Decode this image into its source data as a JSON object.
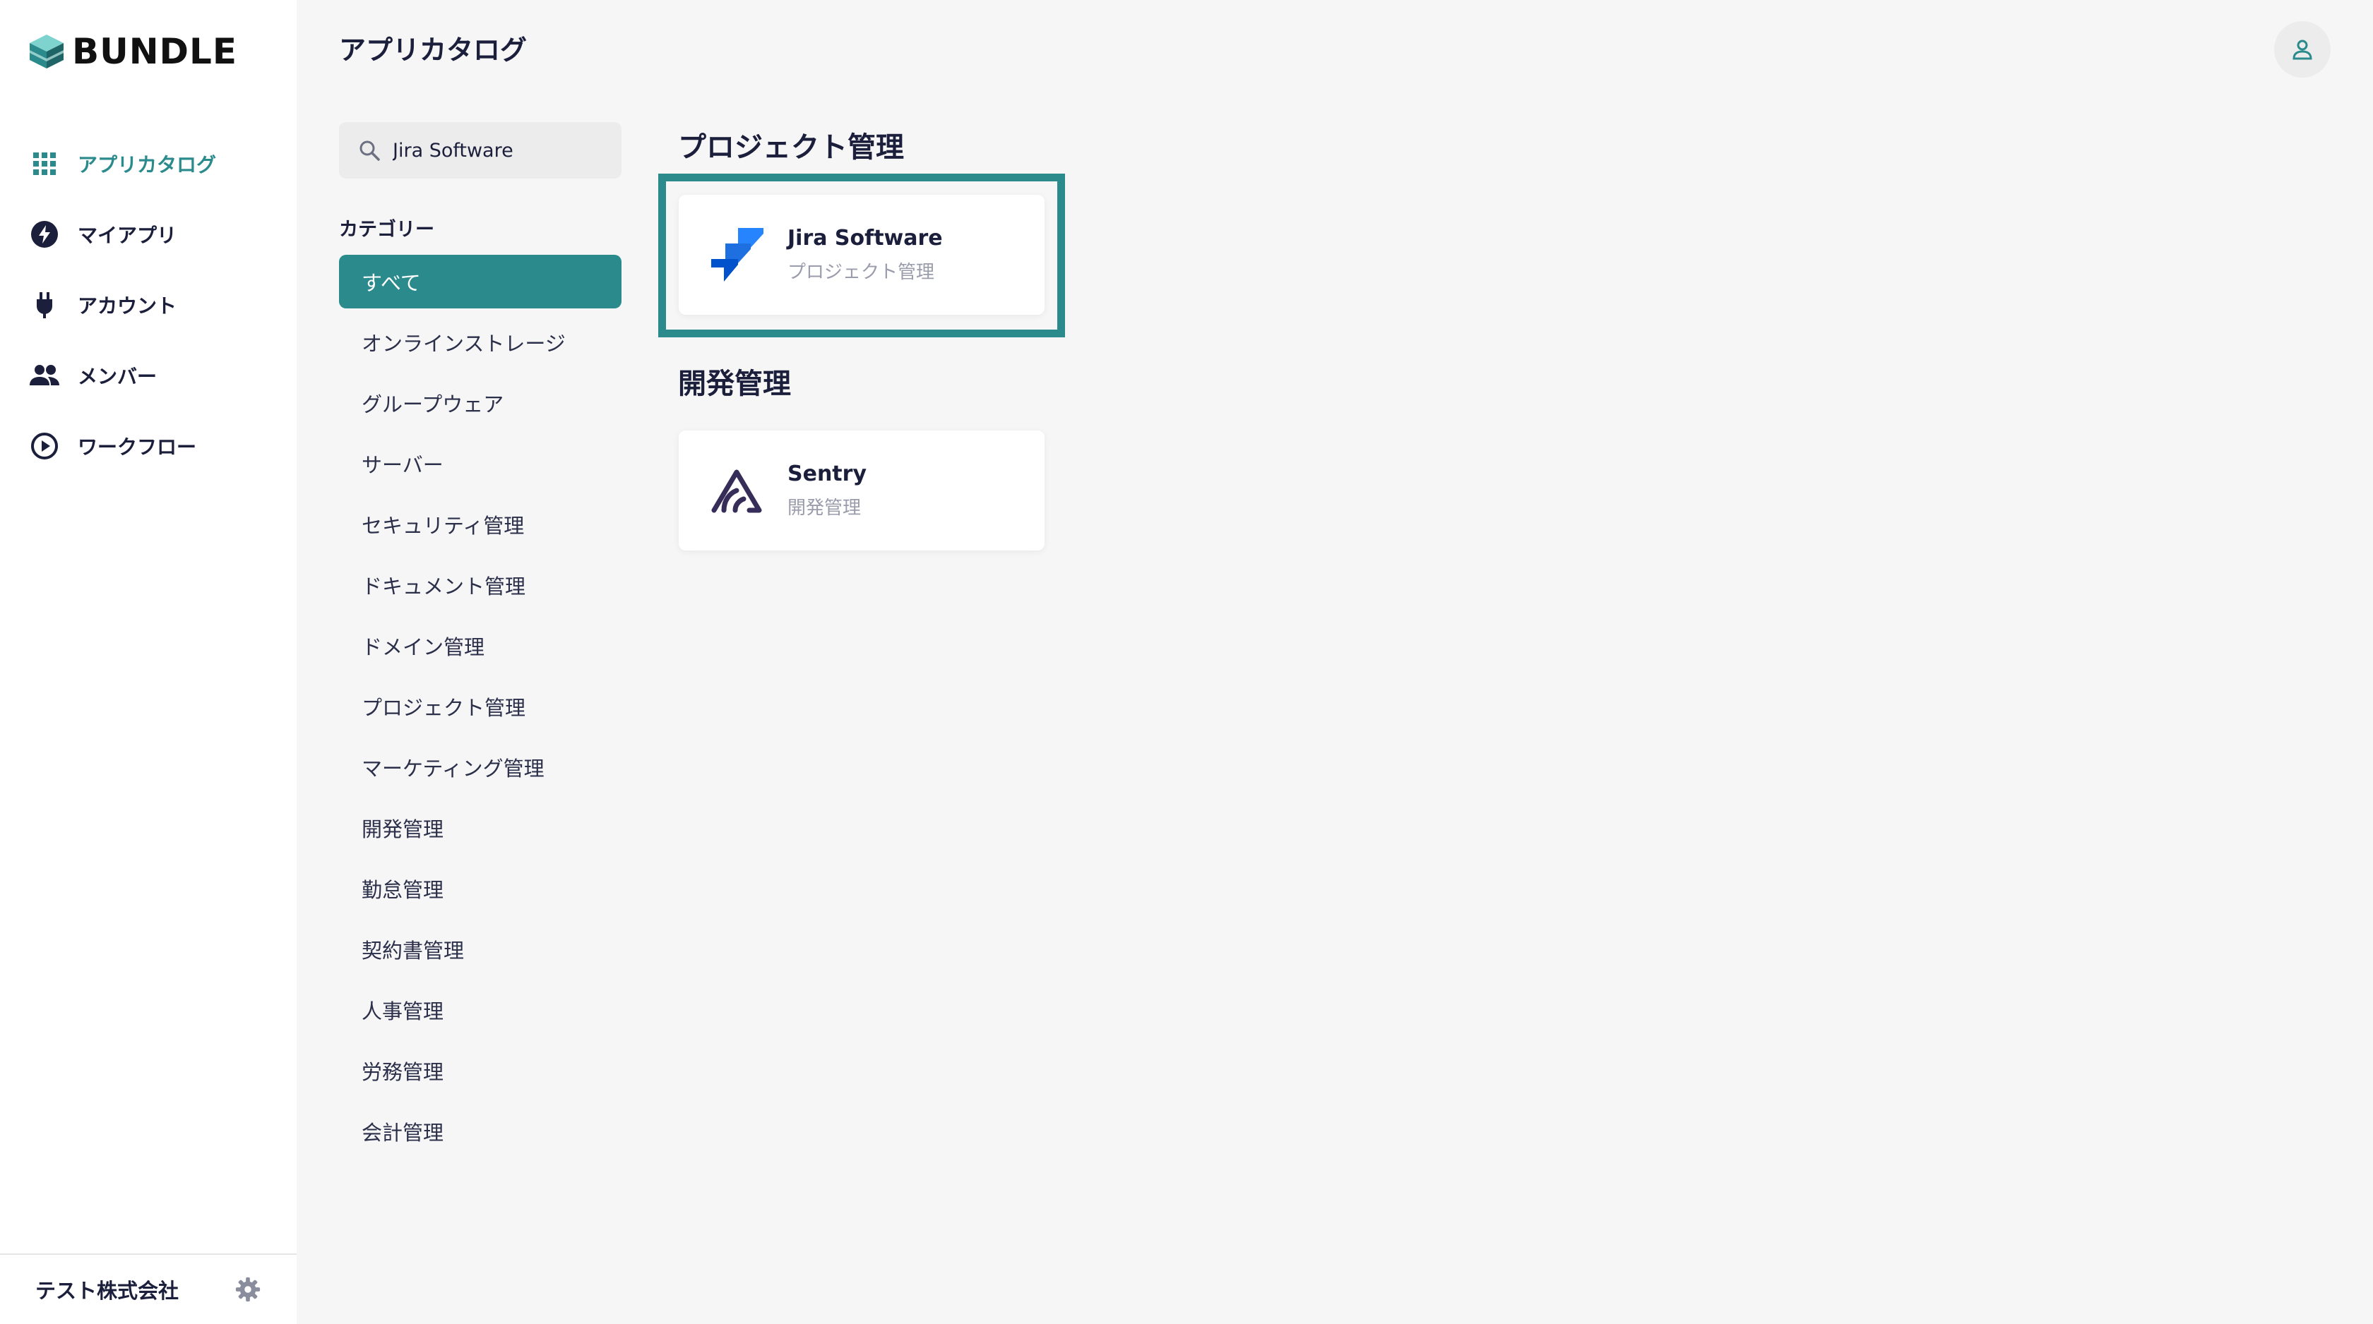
{
  "brand": {
    "name": "BUNDLE",
    "accent": "#2b8b8c"
  },
  "sidebar": {
    "items": [
      {
        "label": "アプリカタログ",
        "icon": "grid-icon",
        "active": true
      },
      {
        "label": "マイアプリ",
        "icon": "lightning-icon",
        "active": false
      },
      {
        "label": "アカウント",
        "icon": "plug-icon",
        "active": false
      },
      {
        "label": "メンバー",
        "icon": "people-icon",
        "active": false
      },
      {
        "label": "ワークフロー",
        "icon": "play-circle-icon",
        "active": false
      }
    ],
    "footer": {
      "company": "テスト株式会社",
      "settings_icon": "gear-icon"
    }
  },
  "header": {
    "title": "アプリカタログ",
    "user_icon": "user-icon"
  },
  "search": {
    "value": "Jira Software",
    "icon": "search-icon"
  },
  "categories": {
    "header": "カテゴリー",
    "items": [
      "すべて",
      "オンラインストレージ",
      "グループウェア",
      "サーバー",
      "セキュリティ管理",
      "ドキュメント管理",
      "ドメイン管理",
      "プロジェクト管理",
      "マーケティング管理",
      "開発管理",
      "勤怠管理",
      "契約書管理",
      "人事管理",
      "労務管理",
      "会計管理"
    ],
    "active_index": 0
  },
  "results": [
    {
      "section": "プロジェクト管理",
      "app": {
        "name": "Jira Software",
        "category": "プロジェクト管理",
        "icon": "jira-icon"
      },
      "highlighted": true
    },
    {
      "section": "開発管理",
      "app": {
        "name": "Sentry",
        "category": "開発管理",
        "icon": "sentry-icon"
      },
      "highlighted": false
    }
  ]
}
